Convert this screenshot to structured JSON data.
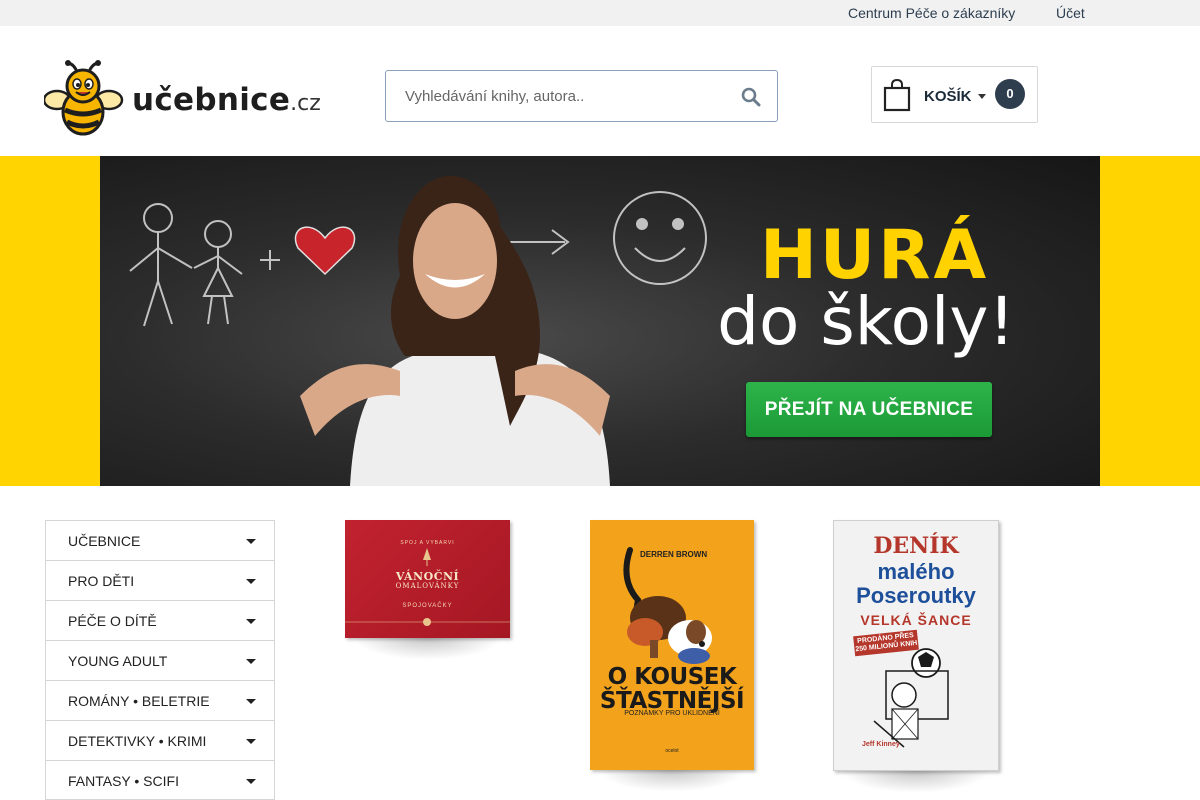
{
  "topbar": {
    "customer_care": "Centrum Péče o zákazníky",
    "account": "Účet"
  },
  "header": {
    "logo_name": "učebnice",
    "logo_tld": ".cz",
    "search_placeholder": "Vyhledávání knihy, autora..",
    "cart_label": "KOŠÍK",
    "cart_count": "0"
  },
  "hero": {
    "headline": "HURÁ",
    "subheadline": "do školy!",
    "cta_label": "PŘEJÍT NA  UČEBNICE",
    "accent_color": "#ffd400",
    "cta_color": "#22a63c"
  },
  "sidebar": {
    "categories": [
      "UČEBNICE",
      "PRO DĚTI",
      "PÉČE O DÍTĚ",
      "YOUNG ADULT",
      "ROMÁNY • BELETRIE",
      "DETEKTIVKY • KRIMI",
      "FANTASY • SCIFI"
    ]
  },
  "books": [
    {
      "cover_top": "SPOJ A VYBARVI",
      "cover_title": "VÁNOČNÍ",
      "cover_subtitle": "OMALOVÁNKY",
      "cover_footer": "SPOJOVAČKY",
      "color": "#b51c29"
    },
    {
      "author": "DERREN BROWN",
      "title_line1": "O KOUSEK",
      "title_line2": "ŠŤASTNĚJŠÍ",
      "subtitle": "POZNÁMKY PRO UKLIDNĚNÍ",
      "publisher": "ocelot",
      "color": "#f3a21c"
    },
    {
      "line1": "DENÍK",
      "line2": "malého",
      "line3": "Poseroutky",
      "line4": "VELKÁ ŠANCE",
      "badge": "PRODÁNO PŘES 250 MILIONŮ KNIH",
      "author": "Jeff Kinney",
      "color": "#f2f2f2"
    }
  ]
}
